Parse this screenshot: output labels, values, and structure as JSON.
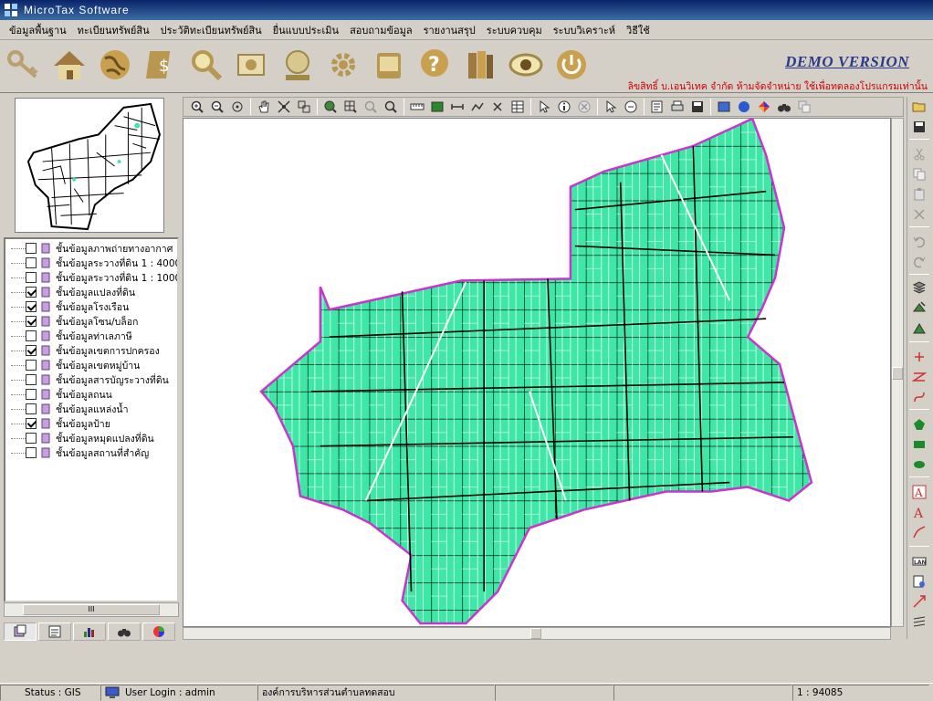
{
  "window": {
    "title": "MicroTax Software"
  },
  "menu": {
    "items": [
      "ข้อมูลพื้นฐาน",
      "ทะเบียนทรัพย์สิน",
      "ประวัติทะเบียนทรัพย์สิน",
      "ยื่นแบบประเมิน",
      "สอบถามข้อมูล",
      "รายงานสรุป",
      "ระบบควบคุม",
      "ระบบวิเคราะห์",
      "วิธีใช้"
    ]
  },
  "banner": {
    "demo": "DEMO VERSION",
    "copyright": "ลิขสิทธิ์ บ.เอนวิเทค จำกัด ห้ามจัดจำหน่าย ใช้เพื่อทดลองโปรแกรมเท่านั้น"
  },
  "bigtoolbar": {
    "icons": [
      "key-icon",
      "house-icon",
      "globe-icon",
      "money-document-icon",
      "magnifier-icon",
      "photo-map-icon",
      "globe-network-icon",
      "gear-settings-icon",
      "database-icon",
      "help-icon",
      "books-icon",
      "eye-icon",
      "power-icon"
    ]
  },
  "layers": [
    {
      "label": "ชั้นข้อมูลภาพถ่ายทางอากาศ",
      "checked": false
    },
    {
      "label": "ชั้นข้อมูลระวางที่ดิน 1 : 4000",
      "checked": false
    },
    {
      "label": "ชั้นข้อมูลระวางที่ดิน 1 : 1000",
      "checked": false
    },
    {
      "label": "ชั้นข้อมูลแปลงที่ดิน",
      "checked": true
    },
    {
      "label": "ชั้นข้อมูลโรงเรือน",
      "checked": true
    },
    {
      "label": "ชั้นข้อมูลโซน/บล็อก",
      "checked": true
    },
    {
      "label": "ชั้นข้อมูลท่าเลภาษี",
      "checked": false
    },
    {
      "label": "ชั้นข้อมูลเขตการปกครอง",
      "checked": true
    },
    {
      "label": "ชั้นข้อมูลเขตหมู่บ้าน",
      "checked": false
    },
    {
      "label": "ชั้นข้อมูลสารบัญระวางที่ดิน",
      "checked": false
    },
    {
      "label": "ชั้นข้อมูลถนน",
      "checked": false
    },
    {
      "label": "ชั้นข้อมูลแหล่งน้ำ",
      "checked": false
    },
    {
      "label": "ชั้นข้อมูลป้าย",
      "checked": true
    },
    {
      "label": "ชั้นข้อมูลหมุดแปลงที่ดิน",
      "checked": false
    },
    {
      "label": "ชั้นข้อมูลสถานที่สำคัญ",
      "checked": false
    }
  ],
  "left_scroll_grip": "III",
  "colors": {
    "parcel_fill": "#3fe7a6",
    "boundary": "#cc33cc",
    "title_bar": "#0a246a",
    "demo_text": "#2b3a8a",
    "copyright_text": "#cc0000"
  },
  "status": {
    "mode": "Status : GIS",
    "user": "User Login : admin",
    "org": "องค์การบริหารส่วนตำบลทดสอบ",
    "scale": "1 : 94085"
  }
}
